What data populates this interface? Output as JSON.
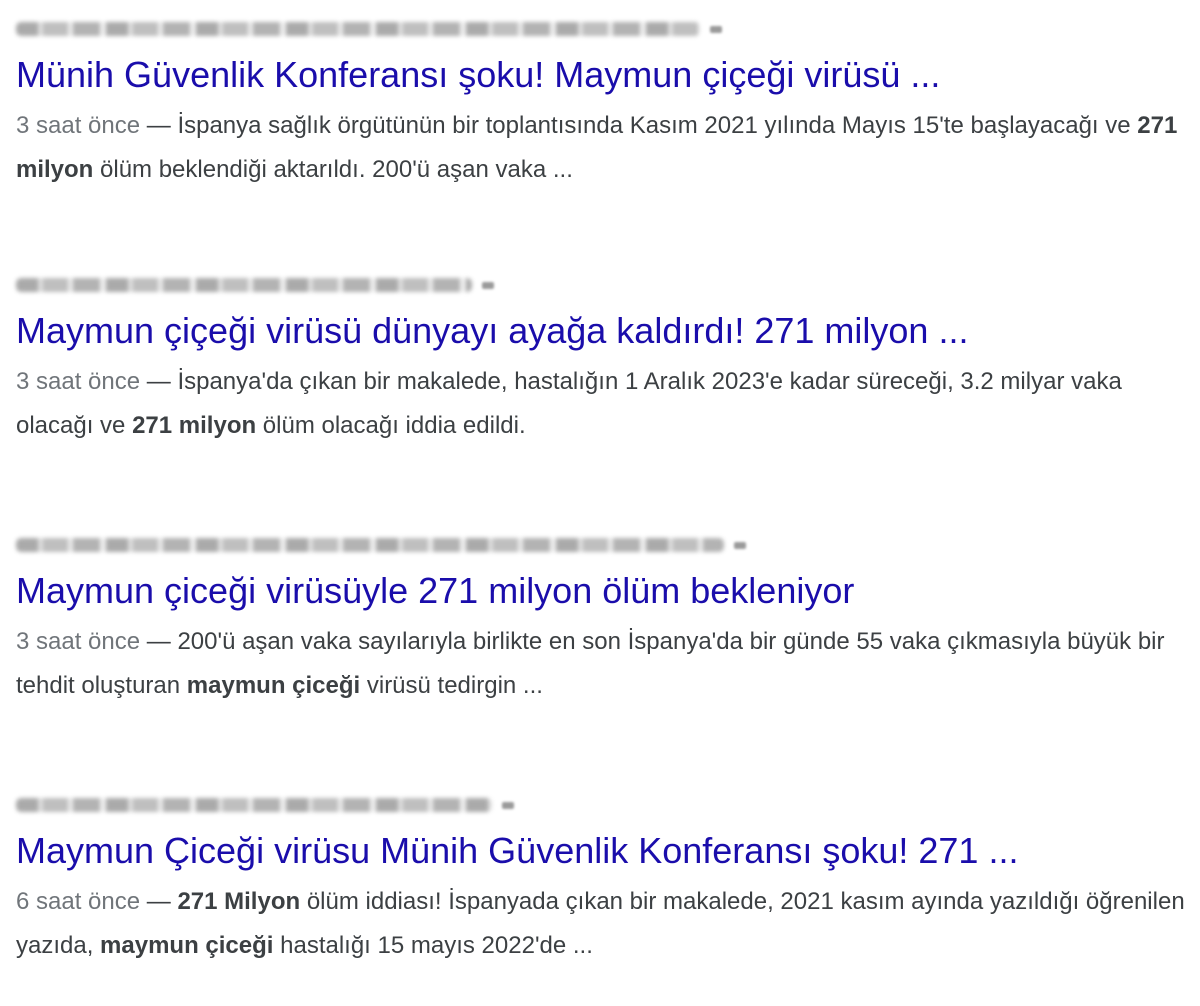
{
  "results": [
    {
      "title": "Münih Güvenlik Konferansı şoku! Maymun çiçeği virüsü ...",
      "date": "3 saat önce",
      "dash": " — ",
      "snippet": {
        "a": "İspanya sağlık örgütünün bir toplantısında Kasım 2021 yılında Mayıs 15'te başlayacağı ve ",
        "b": "271 milyon",
        "c": " ölüm beklendiği aktarıldı. 200'ü aşan vaka ..."
      }
    },
    {
      "title": "Maymun çiçeği virüsü dünyayı ayağa kaldırdı! 271 milyon ...",
      "date": "3 saat önce",
      "dash": " — ",
      "snippet": {
        "a": "İspanya'da çıkan bir makalede, hastalığın 1 Aralık 2023'e kadar süreceği, 3.2 milyar vaka olacağı ve ",
        "b": "271 milyon",
        "c": " ölüm olacağı iddia edildi."
      }
    },
    {
      "title": "Maymun çiceği virüsüyle 271 milyon ölüm bekleniyor",
      "date": "3 saat önce",
      "dash": " — ",
      "snippet": {
        "a": "200'ü aşan vaka sayılarıyla birlikte en son İspanya'da bir günde 55 vaka çıkmasıyla büyük bir tehdit oluşturan ",
        "b": "maymun çiceği",
        "c": " virüsü tedirgin ..."
      }
    },
    {
      "title": "Maymun Çiceği virüsu Münih Güvenlik Konferansı şoku! 271 ...",
      "date": "6 saat önce",
      "dash": " — ",
      "snippet": {
        "a": "",
        "b": "271 Milyon",
        "c": " ölüm iddiası! İspanyada çıkan bir makalede, 2021 kasım ayında yazıldığı öğrenilen yazıda, ",
        "d": "maymun çiceği",
        "e": " hastalığı 15 mayıs 2022'de ..."
      }
    }
  ]
}
